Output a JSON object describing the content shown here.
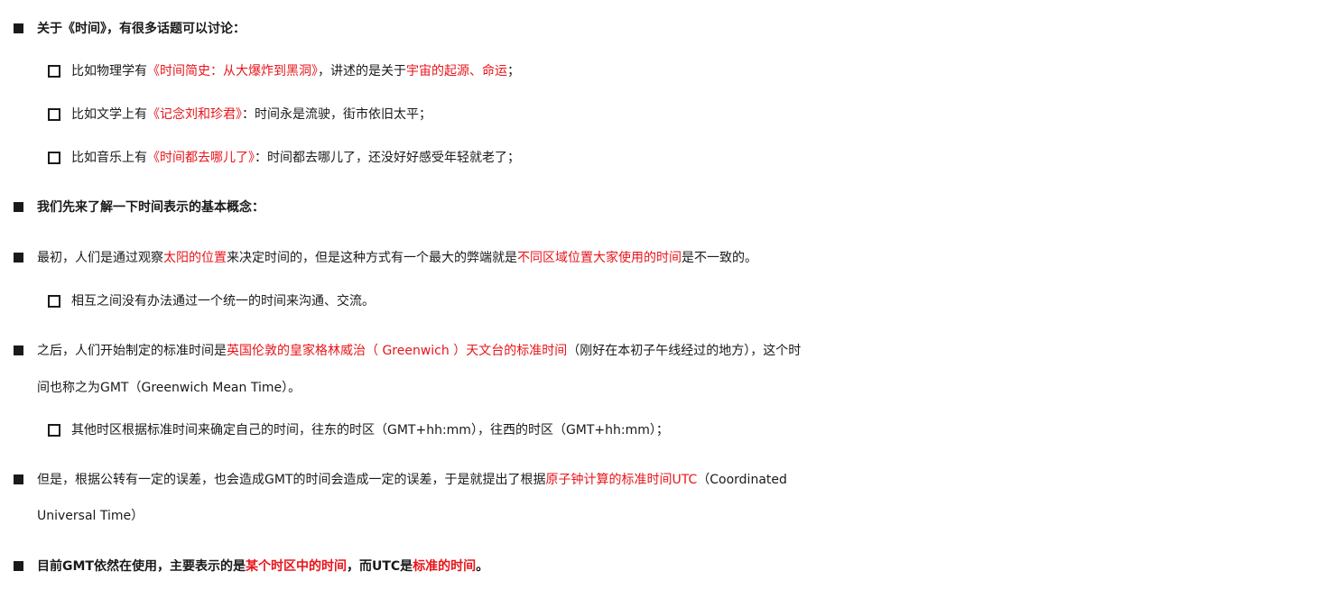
{
  "items": [
    {
      "level": "main",
      "bold": true,
      "segments": [
        {
          "text": "关于《时间》，有很多话题可以讨论：",
          "red": false
        }
      ]
    },
    {
      "level": "sub",
      "bold": false,
      "segments": [
        {
          "text": "比如物理学有",
          "red": false
        },
        {
          "text": "《时间简史：从大爆炸到黑洞》",
          "red": true
        },
        {
          "text": "，讲述的是关于",
          "red": false
        },
        {
          "text": "宇宙的起源、命运",
          "red": true
        },
        {
          "text": "；",
          "red": false
        }
      ]
    },
    {
      "level": "sub",
      "bold": false,
      "segments": [
        {
          "text": "比如文学上有",
          "red": false
        },
        {
          "text": "《记念刘和珍君》",
          "red": true
        },
        {
          "text": "：时间永是流驶，街市依旧太平；",
          "red": false
        }
      ]
    },
    {
      "level": "sub",
      "bold": false,
      "segments": [
        {
          "text": "比如音乐上有",
          "red": false
        },
        {
          "text": "《时间都去哪儿了》",
          "red": true
        },
        {
          "text": "：时间都去哪儿了，还没好好感受年轻就老了；",
          "red": false
        }
      ]
    },
    {
      "level": "main",
      "bold": true,
      "segments": [
        {
          "text": "我们先来了解一下时间表示的基本概念：",
          "red": false
        }
      ]
    },
    {
      "level": "main",
      "bold": false,
      "segments": [
        {
          "text": "最初，人们是通过观察",
          "red": false
        },
        {
          "text": "太阳的位置",
          "red": true
        },
        {
          "text": "来决定时间的，但是这种方式有一个最大的弊端就是",
          "red": false
        },
        {
          "text": "不同区域位置大家使用的时间",
          "red": true
        },
        {
          "text": "是不一致的。",
          "red": false
        }
      ]
    },
    {
      "level": "sub",
      "bold": false,
      "segments": [
        {
          "text": "相互之间没有办法通过一个统一的时间来沟通、交流。",
          "red": false
        }
      ]
    },
    {
      "level": "main",
      "bold": false,
      "segments": [
        {
          "text": "之后，人们开始制定的标准时间是",
          "red": false
        },
        {
          "text": "英国伦敦的皇家格林威治（ Greenwich ）天文台的标准时间",
          "red": true
        },
        {
          "text": "（刚好在本初子午线经过的地方），这个时",
          "red": false
        }
      ],
      "continuation": "间也称之为GMT（Greenwich Mean Time）。"
    },
    {
      "level": "sub",
      "bold": false,
      "segments": [
        {
          "text": "其他时区根据标准时间来确定自己的时间，往东的时区（GMT+hh:mm），往西的时区（GMT+hh:mm）；",
          "red": false
        }
      ]
    },
    {
      "level": "main",
      "bold": false,
      "segments": [
        {
          "text": "但是，根据公转有一定的误差，也会造成GMT的时间会造成一定的误差，于是就提出了根据",
          "red": false
        },
        {
          "text": "原子钟计算的标准时间UTC",
          "red": true
        },
        {
          "text": "（Coordinated",
          "red": false
        }
      ],
      "continuation": "Universal Time）"
    },
    {
      "level": "main",
      "bold": true,
      "segments": [
        {
          "text": "目前GMT依然在使用，主要表示的是",
          "red": false
        },
        {
          "text": "某个时区中的时间",
          "red": true
        },
        {
          "text": "，而UTC是",
          "red": false
        },
        {
          "text": "标准的时间",
          "red": true
        },
        {
          "text": "。",
          "red": false
        }
      ]
    }
  ]
}
